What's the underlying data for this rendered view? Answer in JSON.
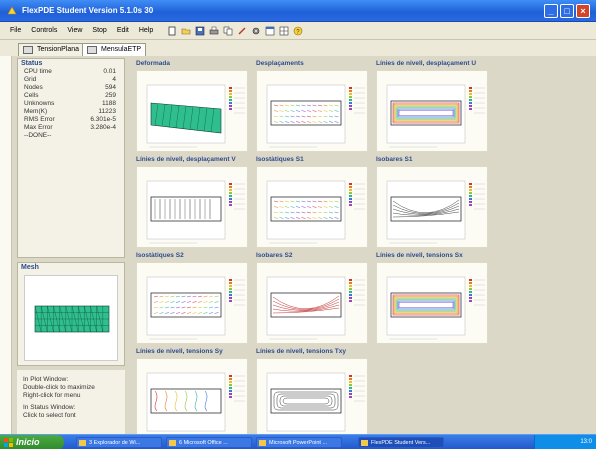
{
  "window": {
    "title": "FlexPDE Student Version 5.1.0s 30"
  },
  "menu": [
    "File",
    "Controls",
    "View",
    "Stop",
    "Edit",
    "Help"
  ],
  "tabs": [
    {
      "label": "TensionPlana",
      "active": false
    },
    {
      "label": "MensulaETP",
      "active": true
    }
  ],
  "status": {
    "title": "Status",
    "rows": [
      {
        "label": "CPU time",
        "value": "0.01"
      },
      {
        "label": "Grid",
        "value": "4"
      },
      {
        "label": "Nodes",
        "value": "594"
      },
      {
        "label": "Cells",
        "value": "259"
      },
      {
        "label": "Unknowns",
        "value": "1188"
      },
      {
        "label": "Mem(K)",
        "value": "11223"
      },
      {
        "label": "RMS Error",
        "value": "6.301e-5"
      },
      {
        "label": "Max Error",
        "value": "3.280e-4"
      }
    ],
    "done": "--DONE--"
  },
  "mesh_panel": {
    "title": "Mesh"
  },
  "help": {
    "plot_window_title": "In Plot Window:",
    "plot_line1": "Double-click to maximize",
    "plot_line2": "Right-click for menu",
    "status_window_title": "In Status Window:",
    "status_line1": "Click to select font"
  },
  "plots": [
    {
      "title": "Deformada",
      "kind": "deformed"
    },
    {
      "title": "Desplaçaments",
      "kind": "vector"
    },
    {
      "title": "Línies de nivell, desplaçament U",
      "kind": "contour"
    },
    {
      "title": "Línies de nivell, desplaçament V",
      "kind": "contour-v"
    },
    {
      "title": "Isostàtiques S1",
      "kind": "vector"
    },
    {
      "title": "Isobares S1",
      "kind": "isobar"
    },
    {
      "title": "Isostàtiques S2",
      "kind": "vector2"
    },
    {
      "title": "Isobares S2",
      "kind": "isobar2"
    },
    {
      "title": "Línies de nivell, tensions Sx",
      "kind": "contour-x"
    },
    {
      "title": "Línies de nivell, tensions Sy",
      "kind": "contour-y"
    },
    {
      "title": "Línies de nivell, tensions Txy",
      "kind": "contour-t"
    }
  ],
  "taskbar": {
    "start": "Inicio",
    "tasks": [
      {
        "label": "3 Explorador de Wi...",
        "active": false
      },
      {
        "label": "6 Microsoft Office ...",
        "active": false
      },
      {
        "label": "Microsoft PowerPoint ...",
        "active": false
      },
      {
        "label": "FlexPDE Student Vers...",
        "active": true
      }
    ],
    "clock": "13:0"
  },
  "colors": {
    "titlebar": "#1f5fd8",
    "plot_title": "#2f4c8c",
    "mesh_fill": "#2fbf8f"
  }
}
